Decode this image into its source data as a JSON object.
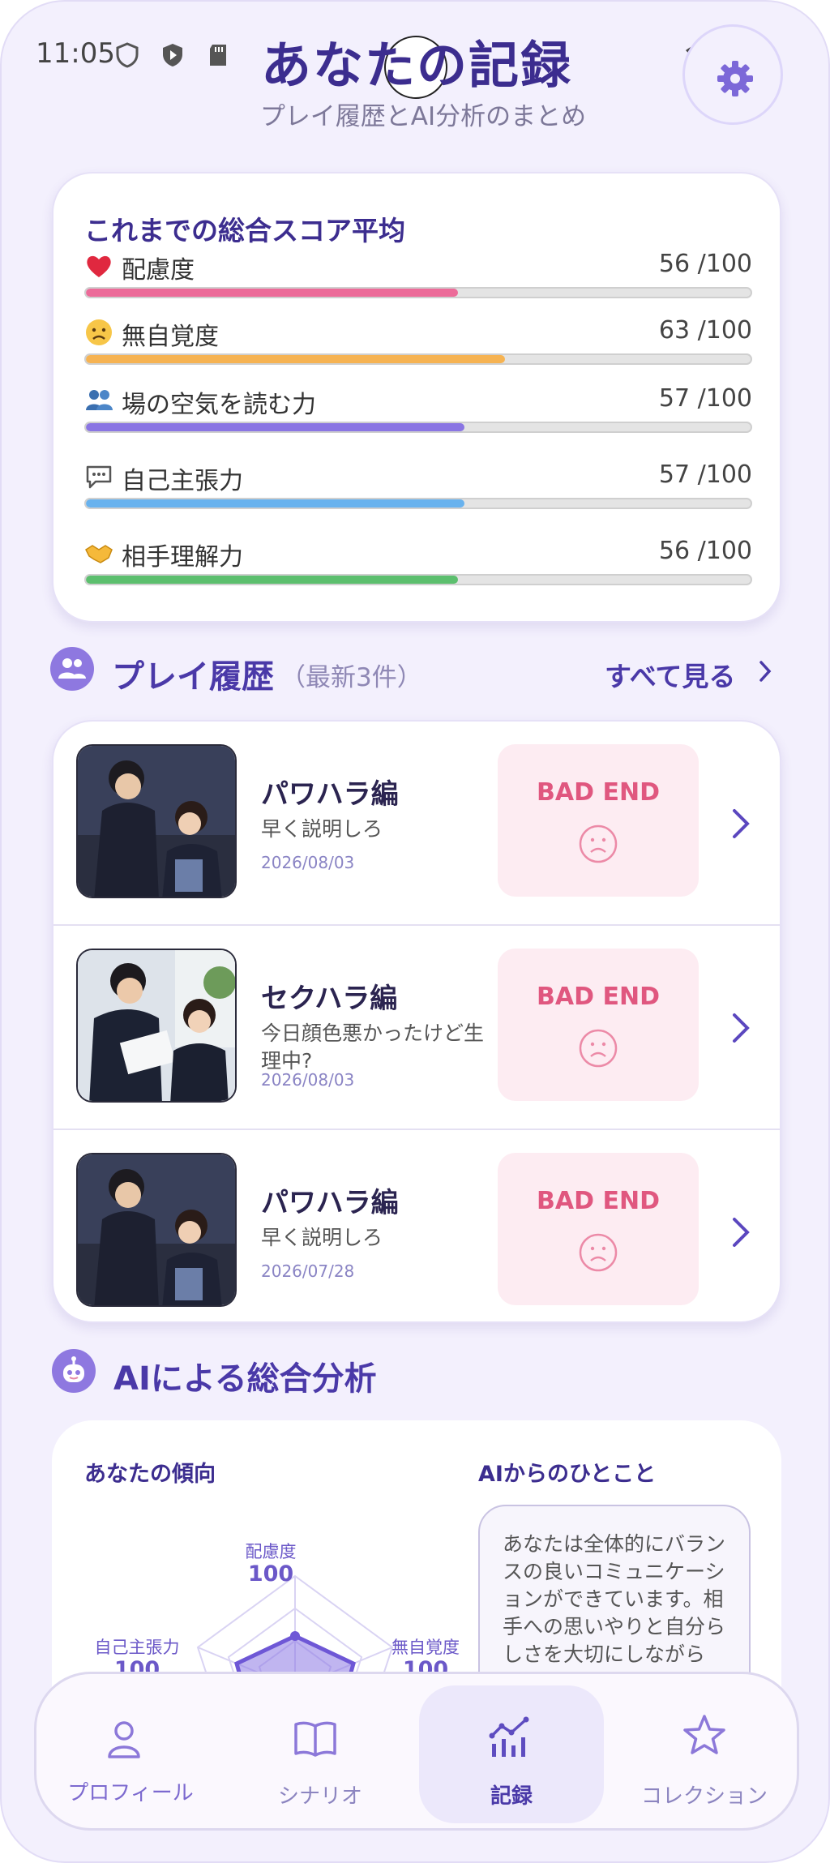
{
  "status_bar": {
    "time": "11:05"
  },
  "header": {
    "title": "あなたの記録",
    "subtitle": "プレイ履歴とAI分析のまとめ"
  },
  "score_card": {
    "title": "これまでの総合スコア平均",
    "metrics": [
      {
        "icon": "heart-icon",
        "label": "配慮度",
        "value": "56 /100",
        "score": 56,
        "color": "#ec6b99"
      },
      {
        "icon": "worried-face-icon",
        "label": "無自覚度",
        "value": "63 /100",
        "score": 63,
        "color": "#f6b352"
      },
      {
        "icon": "people-icon",
        "label": "場の空気を読む力",
        "value": "57 /100",
        "score": 57,
        "color": "#8a75e3"
      },
      {
        "icon": "speech-bubble-icon",
        "label": "自己主張力",
        "value": "57 /100",
        "score": 57,
        "color": "#68b2ee"
      },
      {
        "icon": "handshake-icon",
        "label": "相手理解力",
        "value": "56 /100",
        "score": 56,
        "color": "#5cbf6e"
      }
    ]
  },
  "history_section": {
    "title": "プレイ履歴",
    "subtitle": "（最新3件）",
    "see_all": "すべて見る"
  },
  "history": [
    {
      "title": "パワハラ編",
      "desc": "早く説明しろ",
      "date": "2026/08/03",
      "result": "BAD END"
    },
    {
      "title": "セクハラ編",
      "desc": "今日顔色悪かったけど生理中?",
      "date": "2026/08/03",
      "result": "BAD END"
    },
    {
      "title": "パワハラ編",
      "desc": "早く説明しろ",
      "date": "2026/07/28",
      "result": "BAD END"
    }
  ],
  "analysis_section": {
    "title": "AIによる総合分析",
    "tendency_title": "あなたの傾向",
    "comment_title": "AIからのひとこと",
    "radar": {
      "top": {
        "label": "配慮度",
        "value": "100"
      },
      "left": {
        "label": "自己主張力",
        "value": "100"
      },
      "right": {
        "label": "無自覚度",
        "value": "100"
      }
    },
    "comment": "あなたは全体的にバランスの良いコミュニケーションができています。相手への思いやりと自分らしさを大切にしながら"
  },
  "bottom_nav": {
    "items": [
      {
        "label": "プロフィール",
        "icon": "person-icon",
        "active": false
      },
      {
        "label": "シナリオ",
        "icon": "book-icon",
        "active": false
      },
      {
        "label": "記録",
        "icon": "chart-icon",
        "active": true
      },
      {
        "label": "コレクション",
        "icon": "star-icon",
        "active": false
      }
    ]
  },
  "colors": {
    "accent": "#4a39a8",
    "background": "#f3f0fd",
    "bad_end": "#e0577f"
  }
}
